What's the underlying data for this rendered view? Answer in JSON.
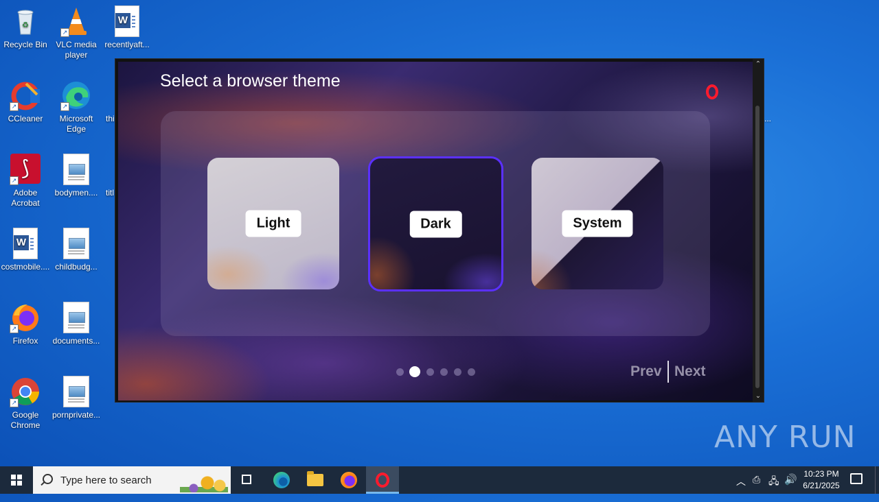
{
  "desktop": {
    "icons": [
      {
        "label": "Recycle Bin"
      },
      {
        "label": "VLC media player"
      },
      {
        "label": "recentlyaft..."
      },
      {
        "label": "CCleaner"
      },
      {
        "label": "Microsoft Edge"
      },
      {
        "label": "Adobe Acrobat"
      },
      {
        "label": "bodymen...."
      },
      {
        "label": "costmobile...."
      },
      {
        "label": "childbudg..."
      },
      {
        "label": "Firefox"
      },
      {
        "label": "documents..."
      },
      {
        "label": "Google Chrome"
      },
      {
        "label": "pornprivate..."
      }
    ],
    "partial_labels": [
      "thi",
      "titl",
      "..."
    ]
  },
  "theme_dialog": {
    "title": "Select a browser theme",
    "options": [
      {
        "label": "Light",
        "selected": false
      },
      {
        "label": "Dark",
        "selected": true
      },
      {
        "label": "System",
        "selected": false
      }
    ],
    "pagination": {
      "total": 6,
      "current": 2
    },
    "prev_label": "Prev",
    "next_label": "Next",
    "accent_color": "#5b30ff"
  },
  "watermark": "ANY RUN",
  "taskbar": {
    "search_placeholder": "Type here to search",
    "apps": [
      "task-view",
      "microsoft-edge",
      "file-explorer",
      "firefox",
      "opera"
    ],
    "active_app": "opera",
    "time": "10:23 PM",
    "date": "6/21/2025"
  }
}
